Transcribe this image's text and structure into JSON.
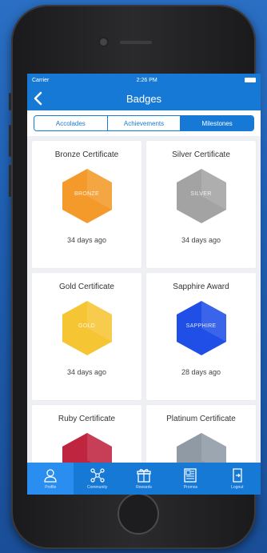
{
  "status": {
    "carrier": "Carrier",
    "time": "2:26 PM"
  },
  "nav": {
    "title": "Badges"
  },
  "segments": [
    {
      "label": "Accolades"
    },
    {
      "label": "Achievements"
    },
    {
      "label": "Milestones"
    }
  ],
  "badges": [
    {
      "title": "Bronze Certificate",
      "hex_label": "BRONZE",
      "date": "34 days ago",
      "color": "#f39a2a"
    },
    {
      "title": "Silver Certificate",
      "hex_label": "SILVER",
      "date": "34 days ago",
      "color": "#a3a3a3"
    },
    {
      "title": "Gold Certificate",
      "hex_label": "GOLD",
      "date": "34 days ago",
      "color": "#f6c534"
    },
    {
      "title": "Sapphire Award",
      "hex_label": "SAPPHIRE",
      "date": "28 days ago",
      "color": "#1f4fe6"
    },
    {
      "title": "Ruby Certificate",
      "hex_label": "",
      "date": "",
      "color": "#c0253f"
    },
    {
      "title": "Platinum Certificate",
      "hex_label": "",
      "date": "",
      "color": "#8f9aa5"
    }
  ],
  "tabs": [
    {
      "label": "Profile",
      "icon": "user-icon"
    },
    {
      "label": "Community",
      "icon": "community-icon"
    },
    {
      "label": "Rewards",
      "icon": "gift-icon"
    },
    {
      "label": "Promos",
      "icon": "newspaper-icon"
    },
    {
      "label": "Logout",
      "icon": "logout-icon"
    }
  ]
}
